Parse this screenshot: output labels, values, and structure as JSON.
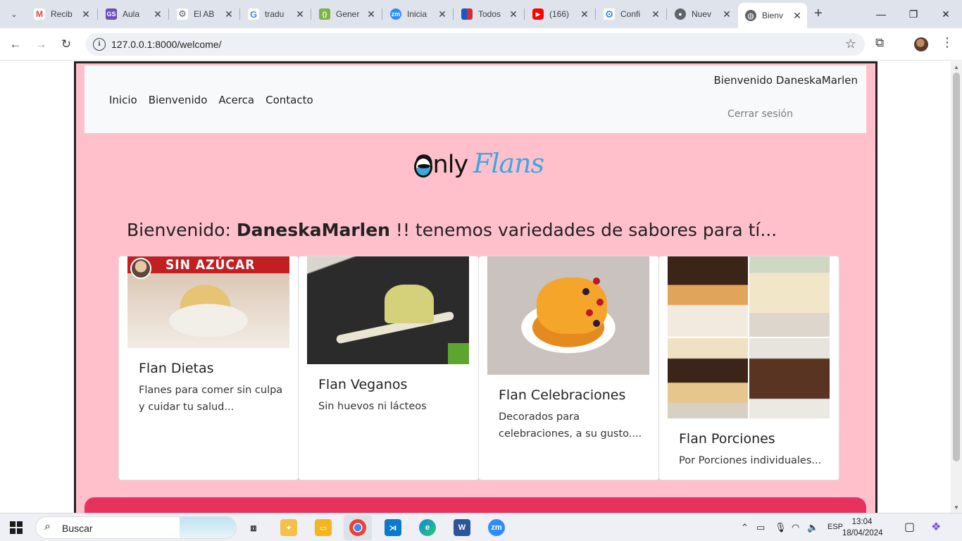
{
  "browser": {
    "tabs": [
      {
        "title": "Recib",
        "favicon": "gmail-icon",
        "color": "#ea4335"
      },
      {
        "title": "Aula",
        "favicon": "gs-icon",
        "color": "#6b4fbb"
      },
      {
        "title": "El AB",
        "favicon": "chip-icon",
        "color": "#5f6368"
      },
      {
        "title": "tradu",
        "favicon": "google-icon",
        "color": "#4285f4"
      },
      {
        "title": "Gener",
        "favicon": "json-icon",
        "color": "#7cb342"
      },
      {
        "title": "Inicia",
        "favicon": "zoom-icon",
        "color": "#2d8cff"
      },
      {
        "title": "Todos",
        "favicon": "flag-icon",
        "color": "#1a56c8"
      },
      {
        "title": "(166)",
        "favicon": "youtube-icon",
        "color": "#ff0000"
      },
      {
        "title": "Confi",
        "favicon": "gear-icon",
        "color": "#1a73e8"
      },
      {
        "title": "Nuev",
        "favicon": "chrome-icon",
        "color": "#5f6368"
      },
      {
        "title": "Bienv",
        "favicon": "globe-icon",
        "color": "#5f6368",
        "active": true
      }
    ],
    "url": "127.0.0.1:8000/welcome/"
  },
  "page": {
    "nav": {
      "links": [
        "Inicio",
        "Bienvenido",
        "Acerca",
        "Contacto"
      ],
      "welcome_user": "Bienvenido DaneskaMarlen",
      "logout": "Cerrar sesión"
    },
    "logo": {
      "part1": "Only",
      "part2": "Flans"
    },
    "headline": {
      "prefix": "Bienvenido: ",
      "username": "DaneskaMarlen",
      "suffix": " !! tenemos variedades de sabores para tí..."
    },
    "cards": [
      {
        "title": "Flan Dietas",
        "text": "Flanes para comer sin culpa y cuidar tu salud...",
        "image_label": "SIN AZÚCAR"
      },
      {
        "title": "Flan Veganos",
        "text": "Sin huevos ni lácteos"
      },
      {
        "title": "Flan Celebraciones",
        "text": "Decorados para celebraciones, a su gusto...."
      },
      {
        "title": "Flan Porciones",
        "text": "Por Porciones individuales..."
      }
    ],
    "colors": {
      "background": "#ffc0cb",
      "footer": "#e8325e",
      "logo_blue": "#3fa6e0"
    }
  },
  "taskbar": {
    "search_placeholder": "Buscar",
    "language": "ESP",
    "time": "13:04",
    "date": "18/04/2024"
  }
}
